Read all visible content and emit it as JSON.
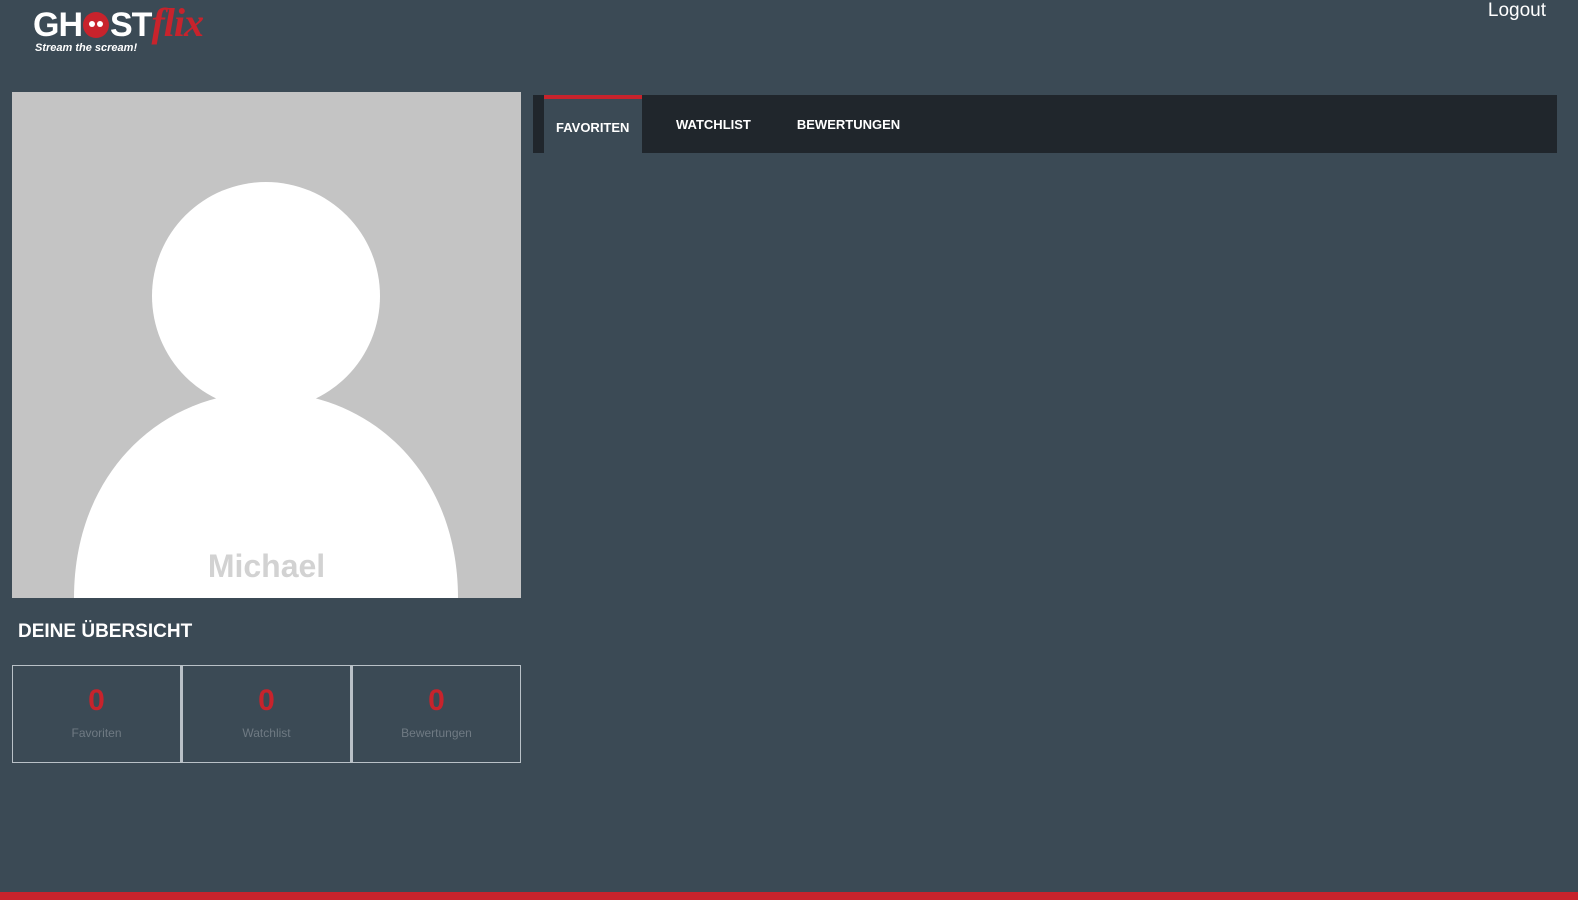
{
  "header": {
    "logo": {
      "text_main": "GHOST",
      "text_accent": "flix",
      "tagline": "Stream the scream!"
    },
    "logout_label": "Logout"
  },
  "profile": {
    "name": "Michael"
  },
  "overview": {
    "title": "DEINE ÜBERSICHT",
    "stats": [
      {
        "value": "0",
        "label": "Favoriten"
      },
      {
        "value": "0",
        "label": "Watchlist"
      },
      {
        "value": "0",
        "label": "Bewertungen"
      }
    ]
  },
  "tabs": [
    {
      "label": "FAVORITEN",
      "active": true
    },
    {
      "label": "WATCHLIST",
      "active": false
    },
    {
      "label": "BEWERTUNGEN",
      "active": false
    }
  ],
  "colors": {
    "background": "#3b4a55",
    "accent": "#c8232c",
    "tabbar": "#20262c",
    "avatar_bg": "#c4c4c4"
  },
  "icons": {
    "logo_skull": "skull-icon",
    "avatar": "user-silhouette-icon"
  }
}
